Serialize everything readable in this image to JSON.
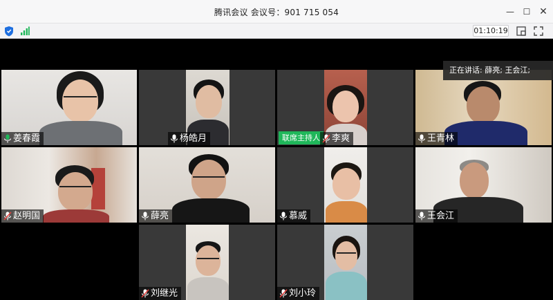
{
  "window": {
    "title": "腾讯会议 会议号：901 715 054",
    "minimize_symbol": "—",
    "maximize_symbol": "☐",
    "close_symbol": "✕"
  },
  "toolbar": {
    "timer": "01:10:19",
    "security_icon": "shield-icon",
    "network_icon": "signal-bars-icon",
    "layout_icon": "layout-icon",
    "fullscreen_icon": "fullscreen-icon"
  },
  "speaking_indicator": "正在讲话: 薛亮; 王会江;",
  "host_action_label": "联席主持人",
  "participants": [
    {
      "name": "姜春霞",
      "mic": "on"
    },
    {
      "name": "杨皓月",
      "mic": "on"
    },
    {
      "name": "李爽",
      "mic": "muted"
    },
    {
      "name": "王青林",
      "mic": "on"
    },
    {
      "name": "赵明国",
      "mic": "muted"
    },
    {
      "name": "薛亮",
      "mic": "on"
    },
    {
      "name": "慕威",
      "mic": "on"
    },
    {
      "name": "王会江",
      "mic": "on"
    },
    {
      "name": "刘继光",
      "mic": "muted"
    },
    {
      "name": "刘小玲",
      "mic": "muted"
    }
  ],
  "colors": {
    "mic_on": "#1fb75a",
    "mic_muted": "#e64340",
    "host_badge": "#1fb75a",
    "shield": "#1e6fe0"
  }
}
